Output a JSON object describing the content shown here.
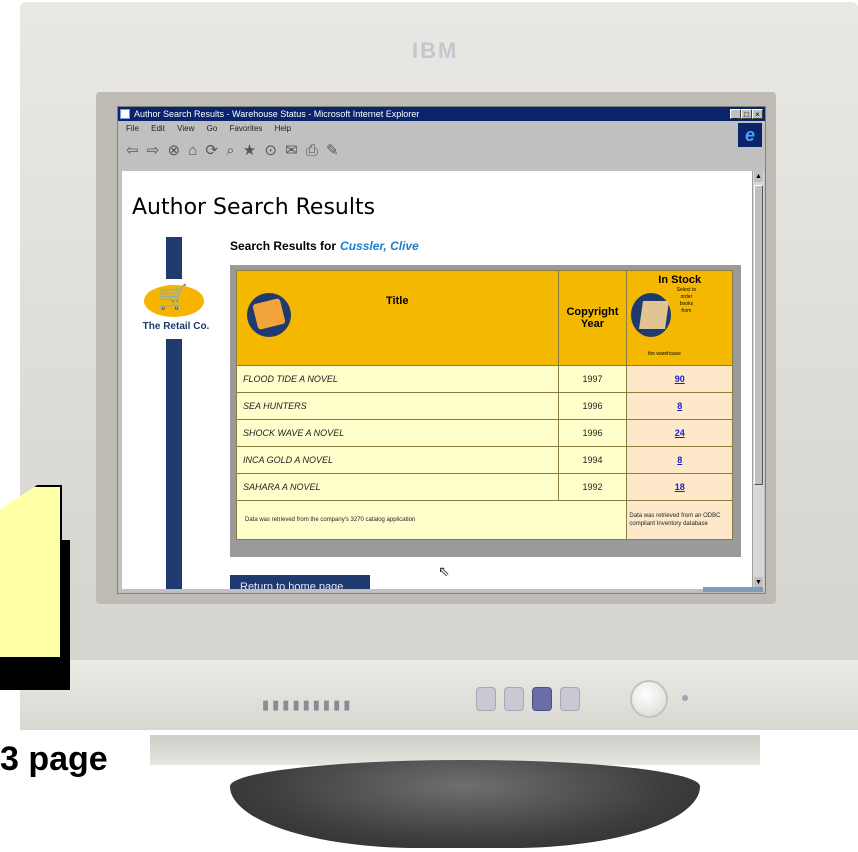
{
  "monitor": {
    "brand": "IBM",
    "vents": "▮▮▮▮▮▮▮▮▮"
  },
  "caption": "3 page",
  "browser": {
    "title": "Author Search Results - Warehouse Status - Microsoft Internet Explorer",
    "menu": [
      "File",
      "Edit",
      "View",
      "Go",
      "Favorites",
      "Help"
    ],
    "toolbar_icons": "⇦ ⇨ ⊗ ⌂ ⟳ ⌕ ★ ⊙ ✉ ⎙ ✎"
  },
  "page": {
    "title": "Author Search Results",
    "logo_text": "The Retail Co.",
    "search_label": "Search Results for",
    "author": "Cussler, Clive",
    "columns": {
      "title": "Title",
      "year": "Copyright Year",
      "stock": "In Stock"
    },
    "stock_note": "Select to order books from",
    "stock_note2": "the warehouse",
    "rows": [
      {
        "title": "FLOOD TIDE A NOVEL",
        "year": "1997",
        "stock": "90"
      },
      {
        "title": "SEA HUNTERS",
        "year": "1996",
        "stock": "8"
      },
      {
        "title": "SHOCK WAVE A NOVEL",
        "year": "1996",
        "stock": "24"
      },
      {
        "title": "INCA GOLD A NOVEL",
        "year": "1994",
        "stock": "8"
      },
      {
        "title": "SAHARA A NOVEL",
        "year": "1992",
        "stock": "18"
      }
    ],
    "footer_left": "Data was retrieved from the company's 3270 catalog application",
    "footer_right": "Data was retrieved from an ODBC compliant Inventory database",
    "return_button": "Return to home page"
  },
  "colors": {
    "header_gold": "#f5b800",
    "row_cream": "#ffffcc",
    "navy": "#1f3a6e",
    "author_blue": "#1a7ed0",
    "callout_yellow": "#ffffa8"
  }
}
